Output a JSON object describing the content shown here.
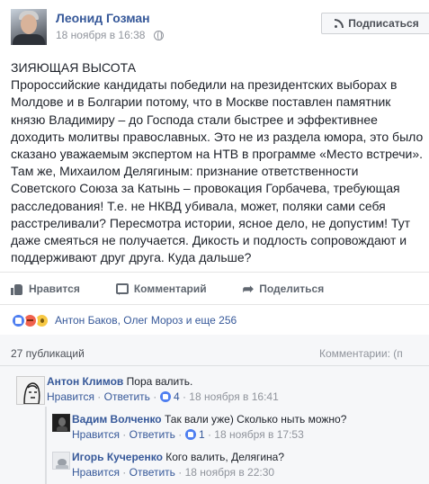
{
  "post": {
    "author": "Леонид Гозман",
    "date": "18 ноября в 16:38",
    "subscribe_label": "Подписаться",
    "lines": [
      "ЗИЯЮЩАЯ ВЫСОТА",
      "Пророссийские кандидаты победили на президентских выборах в",
      "Молдове и в Болгарии потому, что в Москве поставлен памятник",
      "князю Владимиру – до Господа стали быстрее и эффективнее",
      "доходить молитвы православных. Это не из раздела юмора, это было",
      "сказано уважаемым экспертом на НТВ в программе «Место встречи».",
      "Там же, Михаилом Делягиным: признание ответственности",
      "Советского Союза за Катынь – провокация Горбачева, требующая",
      "расследования! Т.е. не НКВД убивала, может, поляки сами себя",
      "расстреливали? Пересмотра истории, ясное дело, не допустим! Тут",
      "даже смеяться не получается. Дикость и подлость сопровождают и",
      "поддерживают друг друга. Куда дальше?"
    ]
  },
  "actions": {
    "like": "Нравится",
    "comment": "Комментарий",
    "share": "Поделиться"
  },
  "reactions": {
    "summary": "Антон Баков, Олег Мороз и еще 256"
  },
  "comments_header": {
    "count": "27 публикаций",
    "order": "Комментарии: (п"
  },
  "comments": [
    {
      "name": "Антон Климов",
      "text": "Пора валить.",
      "like": "Нравится",
      "reply": "Ответить",
      "likes": "4",
      "date": "18 ноября в 16:41"
    },
    {
      "name": "Вадим Волченко",
      "text": "Так вали уже) Сколько ныть можно?",
      "like": "Нравится",
      "reply": "Ответить",
      "likes": "1",
      "date": "18 ноября в 17:53"
    },
    {
      "name": "Игорь Кучеренко",
      "text": "Кого валить, Делягина?",
      "like": "Нравится",
      "reply": "Ответить",
      "date": "18 ноября в 22:30"
    }
  ],
  "colors": {
    "link": "#365899",
    "meta": "#90949c",
    "text": "#1d2129",
    "like_blue": "#4e7ef0",
    "angry": "#f0624e",
    "wow": "#f7c843"
  }
}
